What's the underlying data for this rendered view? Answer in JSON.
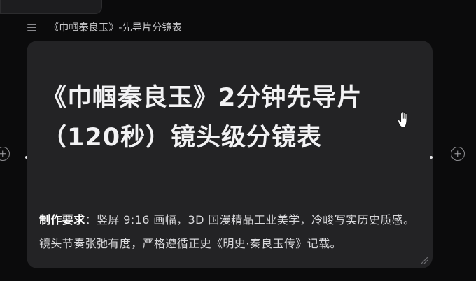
{
  "header": {
    "title": "《巾帼秦良玉》-先导片分镜表"
  },
  "card": {
    "title": "《巾帼秦良玉》2分钟先导片（120秒）镜头级分镜表",
    "body_label": "制作要求",
    "body_text": "：竖屏 9:16 画幅，3D 国漫精品工业美学，冷峻写实历史质感。镜头节奏张弛有度，严格遵循正史《明史·秦良玉传》记载。"
  },
  "icons": {
    "menu": "menu-icon",
    "add_left": "plus-circle-icon",
    "add_right": "plus-circle-icon",
    "cursor": "hand-cursor-icon",
    "resize": "resize-grip-icon"
  }
}
